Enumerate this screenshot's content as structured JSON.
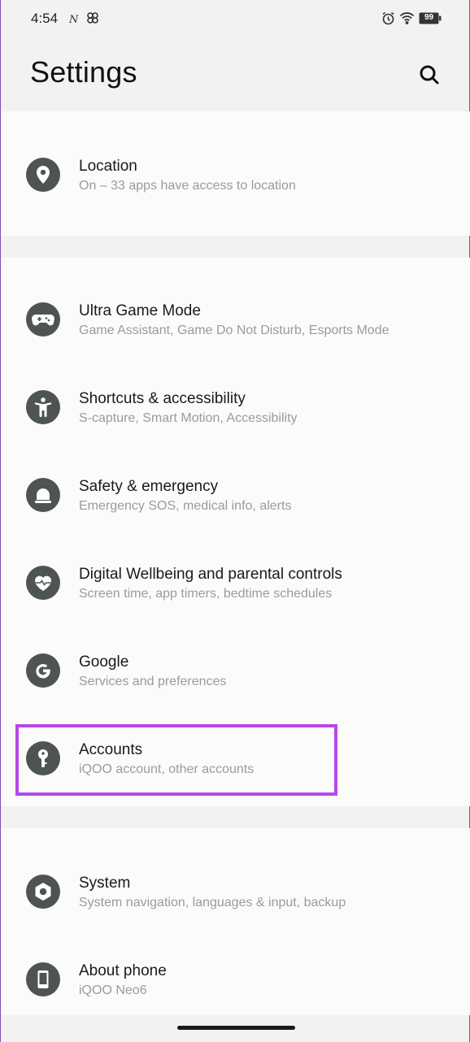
{
  "status_bar": {
    "time": "4:54",
    "battery": "99",
    "icons": [
      "notification-n-icon",
      "pinwheel-icon",
      "alarm-icon",
      "wifi-icon",
      "battery-icon"
    ]
  },
  "header": {
    "title": "Settings",
    "search_icon": "search-icon"
  },
  "sections": [
    {
      "items": [
        {
          "icon": "location-pin-icon",
          "title": "Location",
          "subtitle": "On – 33 apps have access to location"
        }
      ]
    },
    {
      "items": [
        {
          "icon": "gamepad-icon",
          "title": "Ultra Game Mode",
          "subtitle": "Game Assistant, Game Do Not Disturb, Esports Mode"
        },
        {
          "icon": "accessibility-person-icon",
          "title": "Shortcuts & accessibility",
          "subtitle": "S-capture, Smart Motion, Accessibility"
        },
        {
          "icon": "emergency-siren-icon",
          "title": "Safety & emergency",
          "subtitle": "Emergency SOS, medical info, alerts"
        },
        {
          "icon": "heart-wellbeing-icon",
          "title": "Digital Wellbeing and parental controls",
          "subtitle": "Screen time, app timers, bedtime schedules"
        },
        {
          "icon": "google-g-icon",
          "title": "Google",
          "subtitle": "Services and preferences"
        },
        {
          "icon": "key-icon",
          "title": "Accounts",
          "subtitle": "iQOO account, other accounts"
        }
      ]
    },
    {
      "items": [
        {
          "icon": "gear-hexagon-icon",
          "title": "System",
          "subtitle": "System navigation, languages & input, backup"
        },
        {
          "icon": "phone-icon",
          "title": "About phone",
          "subtitle": "iQOO Neo6"
        }
      ]
    }
  ],
  "colors": {
    "highlight": "#b548ea",
    "icon_bg": "#4e5551",
    "subtitle": "#9b9b9b"
  }
}
